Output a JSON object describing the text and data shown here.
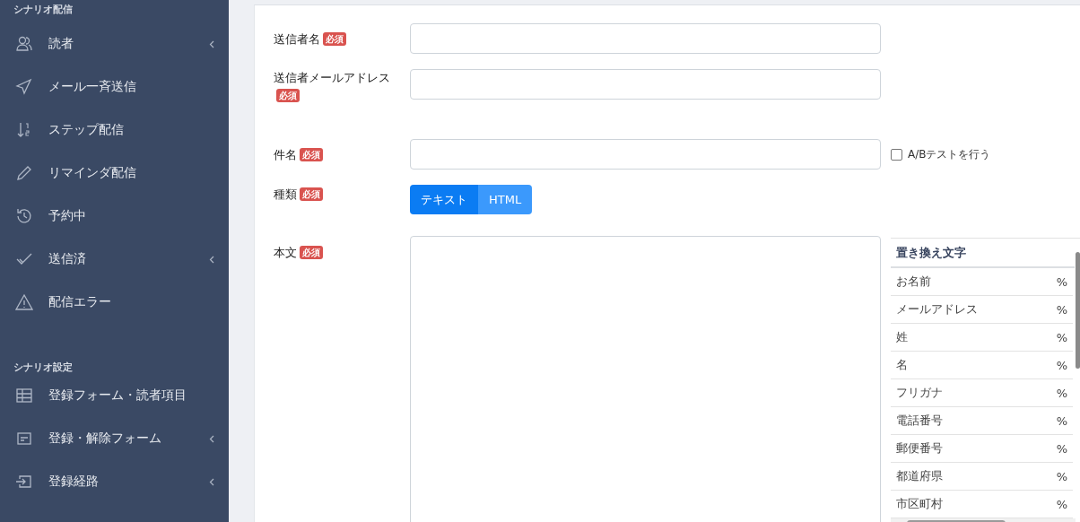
{
  "sidebar": {
    "sections": [
      {
        "heading": "シナリオ配信",
        "items": [
          {
            "label": "読者",
            "has_submenu": true
          },
          {
            "label": "メール一斉送信",
            "has_submenu": false
          },
          {
            "label": "ステップ配信",
            "has_submenu": false
          },
          {
            "label": "リマインダ配信",
            "has_submenu": false
          },
          {
            "label": "予約中",
            "has_submenu": false
          },
          {
            "label": "送信済",
            "has_submenu": true
          },
          {
            "label": "配信エラー",
            "has_submenu": false
          }
        ]
      },
      {
        "heading": "シナリオ設定",
        "items": [
          {
            "label": "登録フォーム・読者項目",
            "has_submenu": false
          },
          {
            "label": "登録・解除フォーム",
            "has_submenu": true
          },
          {
            "label": "登録経路",
            "has_submenu": true
          }
        ]
      }
    ]
  },
  "form": {
    "fields": [
      {
        "kind": "text",
        "label": "送信者名",
        "badge": "必須"
      },
      {
        "kind": "text",
        "label": "送信者メールアドレス",
        "badge": "必須"
      },
      {
        "kind": "text",
        "label": "件名",
        "badge": "必須",
        "option": {
          "label": "A/Bテストを行う",
          "checked": false
        }
      },
      {
        "kind": "toggle",
        "label": "種類",
        "badge": "必須",
        "options": [
          {
            "label": "テキスト",
            "selected": true
          },
          {
            "label": "HTML",
            "selected": false
          }
        ]
      },
      {
        "kind": "textarea",
        "label": "本文",
        "badge": "必須"
      }
    ]
  },
  "replacements": {
    "heading": "置き換え文字",
    "rows": [
      {
        "name": "お名前",
        "code": "%"
      },
      {
        "name": "メールアドレス",
        "code": "%"
      },
      {
        "name": "姓",
        "code": "%"
      },
      {
        "name": "名",
        "code": "%"
      },
      {
        "name": "フリガナ",
        "code": "%"
      },
      {
        "name": "電話番号",
        "code": "%"
      },
      {
        "name": "郵便番号",
        "code": "%"
      },
      {
        "name": "都道府県",
        "code": "%"
      },
      {
        "name": "市区町村",
        "code": "%"
      }
    ]
  }
}
